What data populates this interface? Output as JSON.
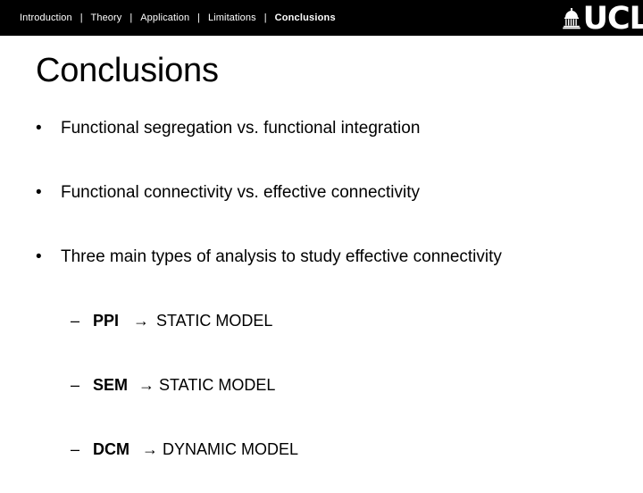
{
  "header": {
    "nav_items": [
      {
        "label": "Introduction",
        "active": false
      },
      {
        "label": "Theory",
        "active": false
      },
      {
        "label": "Application",
        "active": false
      },
      {
        "label": "Limitations",
        "active": false
      },
      {
        "label": "Conclusions",
        "active": true
      }
    ],
    "separator": "|",
    "logo": {
      "icon": "ucl-portico-icon",
      "text": "UCL"
    },
    "background_color": "#000000",
    "text_color": "#ffffff"
  },
  "slide": {
    "title": "Conclusions",
    "bullet_marker": "•",
    "sub_marker": "–",
    "arrow": "→",
    "bullets": [
      {
        "text": "Functional segregation vs. functional integration"
      },
      {
        "text": "Functional connectivity vs. effective connectivity"
      },
      {
        "text": "Three main types of analysis to study effective connectivity"
      }
    ],
    "sub_bullets": [
      {
        "label": "PPI",
        "model": "STATIC MODEL"
      },
      {
        "label": "SEM",
        "model": "STATIC MODEL"
      },
      {
        "label": "DCM",
        "model": "DYNAMIC MODEL"
      }
    ],
    "background_color": "#ffffff",
    "text_color": "#000000"
  }
}
